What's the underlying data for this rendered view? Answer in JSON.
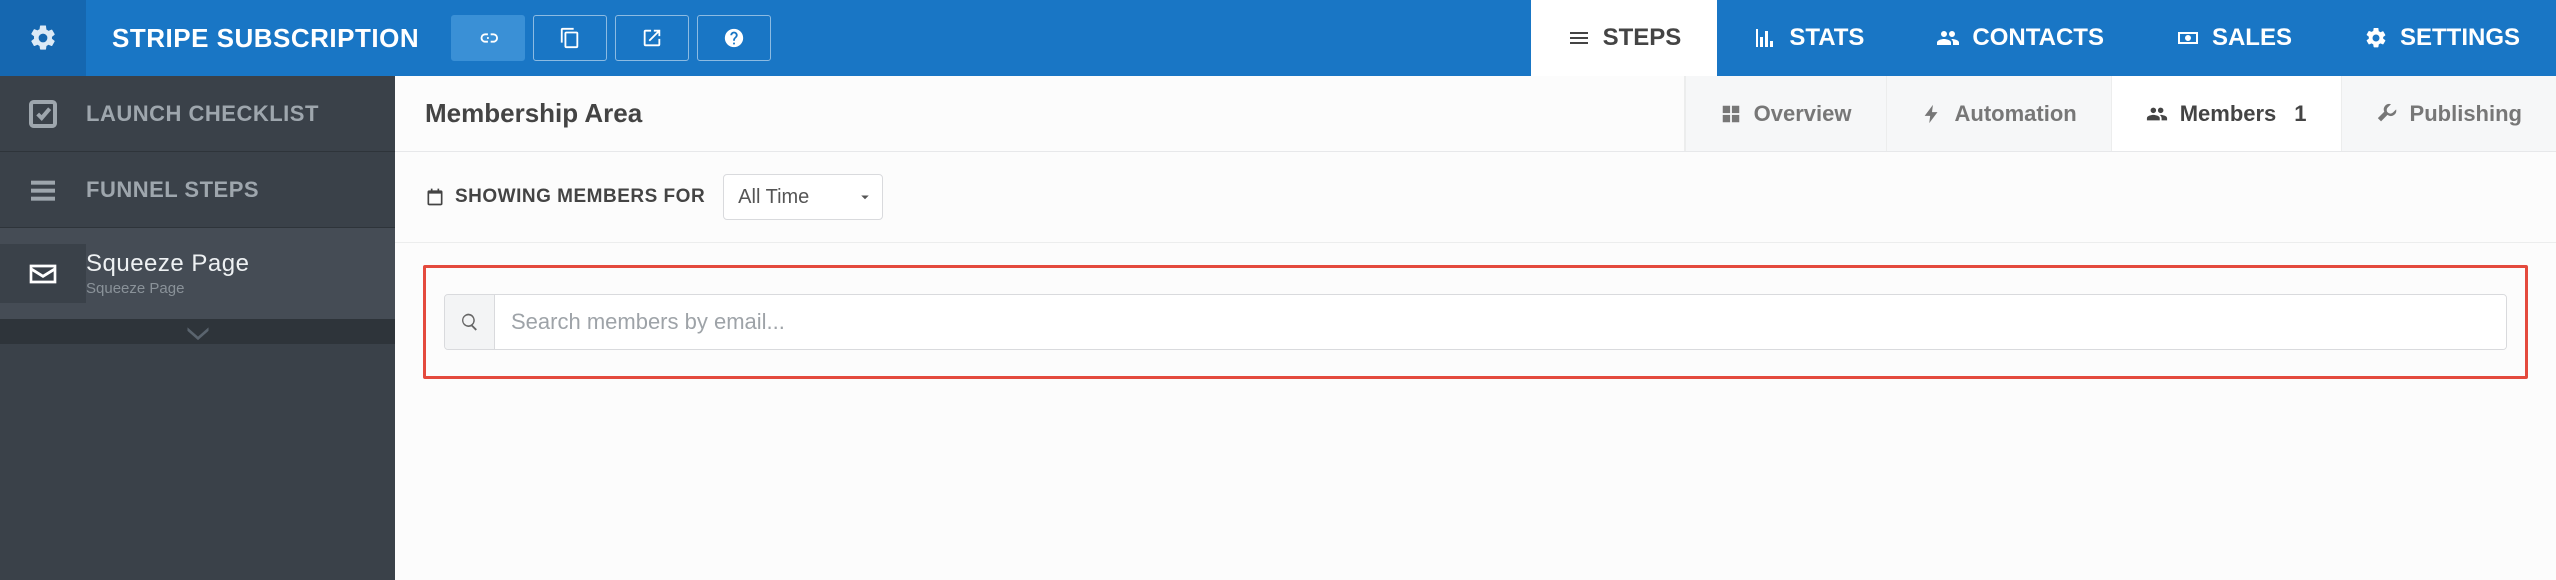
{
  "topbar": {
    "title": "STRIPE SUBSCRIPTION"
  },
  "topnav": {
    "steps": "STEPS",
    "stats": "STATS",
    "contacts": "CONTACTS",
    "sales": "SALES",
    "settings": "SETTINGS"
  },
  "sidebar": {
    "launch_checklist": "LAUNCH CHECKLIST",
    "funnel_steps": "FUNNEL STEPS",
    "squeeze": {
      "title": "Squeeze Page",
      "subtitle": "Squeeze Page"
    }
  },
  "content": {
    "heading": "Membership Area",
    "tabs": {
      "overview": "Overview",
      "automation": "Automation",
      "members": "Members",
      "members_count": "1",
      "publishing": "Publishing"
    },
    "filter": {
      "label": "SHOWING MEMBERS FOR",
      "selected": "All Time"
    },
    "search": {
      "placeholder": "Search members by email..."
    }
  }
}
